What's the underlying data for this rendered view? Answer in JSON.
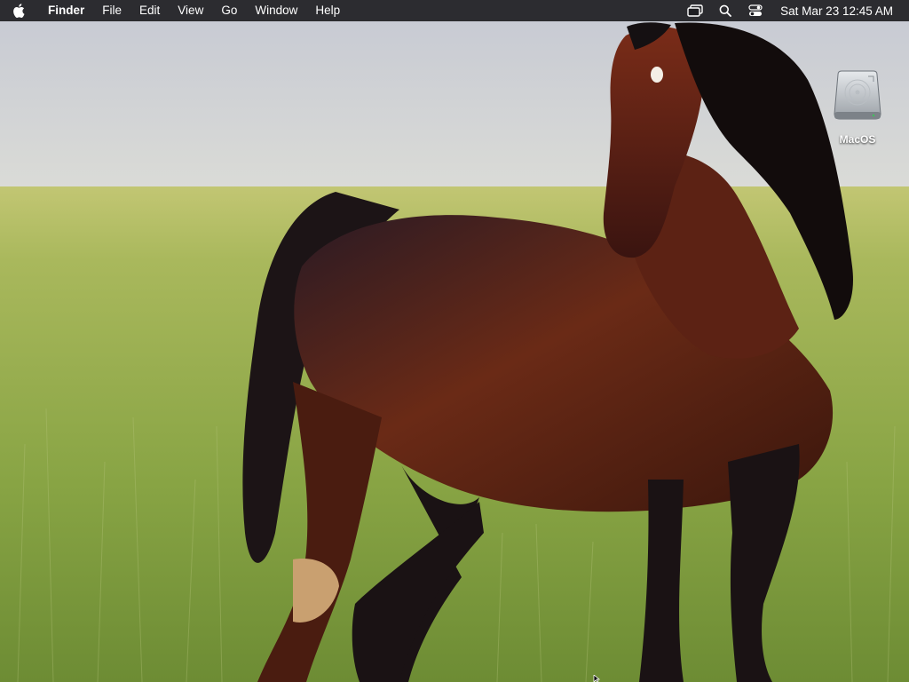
{
  "menubar": {
    "apple_icon": "apple-logo-icon",
    "app_name": "Finder",
    "items": [
      "File",
      "Edit",
      "View",
      "Go",
      "Window",
      "Help"
    ],
    "status_icons": [
      "screen-mirroring-icon",
      "spotlight-search-icon",
      "control-center-icon"
    ],
    "clock": "Sat Mar 23  12:45 AM"
  },
  "desktop": {
    "wallpaper": "horse-in-grass-field",
    "icons": [
      {
        "label": "MacOS",
        "icon": "hard-disk-icon"
      }
    ]
  },
  "colors": {
    "menubar_bg": "#1e1e22",
    "menubar_text": "#ffffff",
    "sky": "#cfd2d8",
    "grass": "#8fa84a",
    "horse": "#5a1f12"
  }
}
